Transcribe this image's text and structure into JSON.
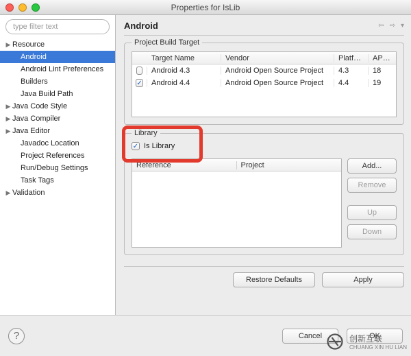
{
  "window": {
    "title": "Properties for IsLib"
  },
  "sidebar": {
    "filter_placeholder": "type filter text",
    "items": [
      {
        "label": "Resource",
        "expandable": true,
        "indent": 0
      },
      {
        "label": "Android",
        "expandable": false,
        "indent": 1,
        "selected": true
      },
      {
        "label": "Android Lint Preferences",
        "expandable": false,
        "indent": 1
      },
      {
        "label": "Builders",
        "expandable": false,
        "indent": 1
      },
      {
        "label": "Java Build Path",
        "expandable": false,
        "indent": 1
      },
      {
        "label": "Java Code Style",
        "expandable": true,
        "indent": 0
      },
      {
        "label": "Java Compiler",
        "expandable": true,
        "indent": 0
      },
      {
        "label": "Java Editor",
        "expandable": true,
        "indent": 0
      },
      {
        "label": "Javadoc Location",
        "expandable": false,
        "indent": 1
      },
      {
        "label": "Project References",
        "expandable": false,
        "indent": 1
      },
      {
        "label": "Run/Debug Settings",
        "expandable": false,
        "indent": 1
      },
      {
        "label": "Task Tags",
        "expandable": false,
        "indent": 1
      },
      {
        "label": "Validation",
        "expandable": true,
        "indent": 0
      }
    ]
  },
  "main": {
    "heading": "Android",
    "build_target": {
      "legend": "Project Build Target",
      "columns": {
        "name": "Target Name",
        "vendor": "Vendor",
        "platform": "Platform",
        "api": "API Le"
      },
      "rows": [
        {
          "checked": false,
          "name": "Android 4.3",
          "vendor": "Android Open Source Project",
          "platform": "4.3",
          "api": "18"
        },
        {
          "checked": true,
          "name": "Android 4.4",
          "vendor": "Android Open Source Project",
          "platform": "4.4",
          "api": "19"
        }
      ]
    },
    "library": {
      "legend": "Library",
      "is_library_label": "Is Library",
      "is_library_checked": true,
      "ref_columns": {
        "reference": "Reference",
        "project": "Project"
      },
      "buttons": {
        "add": "Add...",
        "remove": "Remove",
        "up": "Up",
        "down": "Down"
      }
    },
    "footer": {
      "restore": "Restore Defaults",
      "apply": "Apply"
    }
  },
  "bottom": {
    "cancel": "Cancel",
    "ok": "OK"
  },
  "watermark": {
    "brand": "创新互联",
    "sub": "CHUANG XIN HU LIAN"
  }
}
